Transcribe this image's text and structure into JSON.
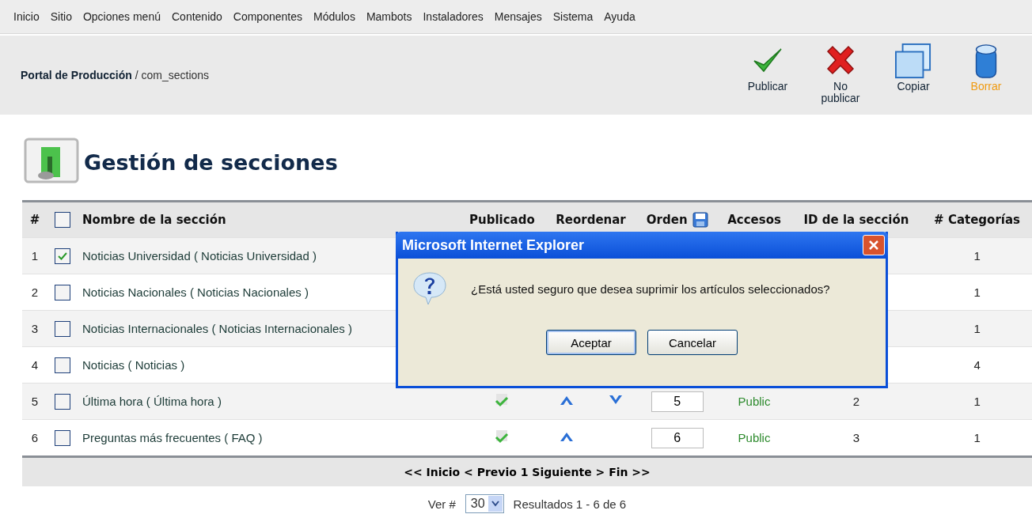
{
  "menu": [
    "Inicio",
    "Sitio",
    "Opciones menú",
    "Contenido",
    "Componentes",
    "Módulos",
    "Mambots",
    "Instaladores",
    "Mensajes",
    "Sistema",
    "Ayuda"
  ],
  "breadcrumb": {
    "site": "Portal de Producción",
    "path": "/ com_sections"
  },
  "toolbar": [
    {
      "kind": "publish",
      "label": "Publicar",
      "highlighted": false
    },
    {
      "kind": "unpublish",
      "label": "No publicar",
      "highlighted": false
    },
    {
      "kind": "copy",
      "label": "Copiar",
      "highlighted": false
    },
    {
      "kind": "delete",
      "label": "Borrar",
      "highlighted": true
    }
  ],
  "page_title": "Gestión de secciones",
  "table": {
    "columns": [
      "#",
      "Nombre de la sección",
      "Publicado",
      "Reordenar",
      "Orden",
      "Accesos",
      "ID de la sección",
      "# Categorías"
    ],
    "select_all": false,
    "rows": [
      {
        "num": "1",
        "checked": true,
        "name": "Noticias Universidad ( Noticias Universidad )",
        "categories": "1"
      },
      {
        "num": "2",
        "checked": false,
        "name": "Noticias Nacionales ( Noticias Nacionales )",
        "categories": "1"
      },
      {
        "num": "3",
        "checked": false,
        "name": "Noticias Internacionales ( Noticias Internacionales )",
        "categories": "1"
      },
      {
        "num": "4",
        "checked": false,
        "name": "Noticias ( Noticias )",
        "categories": "4"
      },
      {
        "num": "5",
        "checked": false,
        "name": "Última hora ( Última hora )",
        "published": true,
        "up": true,
        "down": true,
        "order": "5",
        "access": "Public",
        "id": "2",
        "categories": "1"
      },
      {
        "num": "6",
        "checked": false,
        "name": "Preguntas más frecuentes ( FAQ )",
        "published": true,
        "up": true,
        "down": false,
        "order": "6",
        "access": "Public",
        "id": "3",
        "categories": "1"
      }
    ]
  },
  "pagination": {
    "links": "<< Inicio < Previo 1 Siguiente > Fin >>",
    "show_label": "Ver #",
    "page_size": "30",
    "results": "Resultados 1 - 6 de 6"
  },
  "dialog": {
    "title": "Microsoft Internet Explorer",
    "message": "¿Está usted seguro que desea suprimir los artículos seleccionados?",
    "buttons": [
      "Aceptar",
      "Cancelar"
    ]
  }
}
